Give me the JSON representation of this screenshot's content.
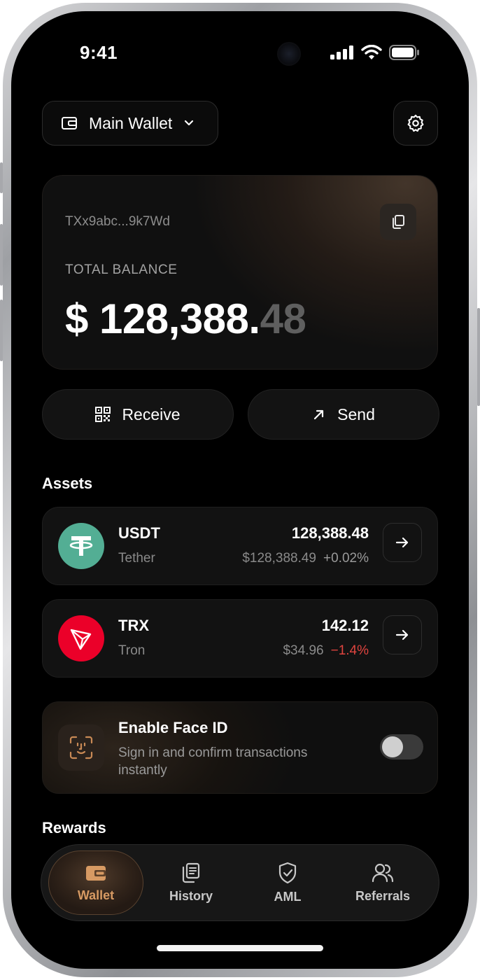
{
  "status_bar": {
    "time": "9:41"
  },
  "header": {
    "wallet_label": "Main Wallet",
    "wallet_icon": "wallet-icon",
    "settings_icon": "gear-icon"
  },
  "balance_card": {
    "address": "TXx9abc...9k7Wd",
    "total_label": "TOTAL BALANCE",
    "amount_main": "$ 128,388.",
    "amount_cents": "48"
  },
  "actions": {
    "receive_label": "Receive",
    "send_label": "Send"
  },
  "assets": {
    "title": "Assets",
    "items": [
      {
        "symbol": "USDT",
        "name": "Tether",
        "amount": "128,388.48",
        "fiat": "$128,388.49",
        "change": "+0.02%",
        "change_color": "#9a9a9a",
        "icon_color": "#53ae94"
      },
      {
        "symbol": "TRX",
        "name": "Tron",
        "amount": "142.12",
        "fiat": "$34.96",
        "change": "−1.4%",
        "change_color": "#e0443f",
        "icon_color": "#eb0029"
      }
    ]
  },
  "face_id": {
    "title": "Enable Face ID",
    "description": "Sign in and confirm transactions instantly",
    "enabled": false
  },
  "rewards": {
    "title": "Rewards"
  },
  "tabbar": {
    "items": [
      {
        "label": "Wallet",
        "icon": "wallet-icon",
        "active": true
      },
      {
        "label": "History",
        "icon": "history-icon",
        "active": false
      },
      {
        "label": "AML",
        "icon": "shield-check-icon",
        "active": false
      },
      {
        "label": "Referrals",
        "icon": "users-icon",
        "active": false
      }
    ]
  },
  "colors": {
    "accent": "#d79a63",
    "positive": "#9a9a9a",
    "negative": "#e0443f"
  }
}
